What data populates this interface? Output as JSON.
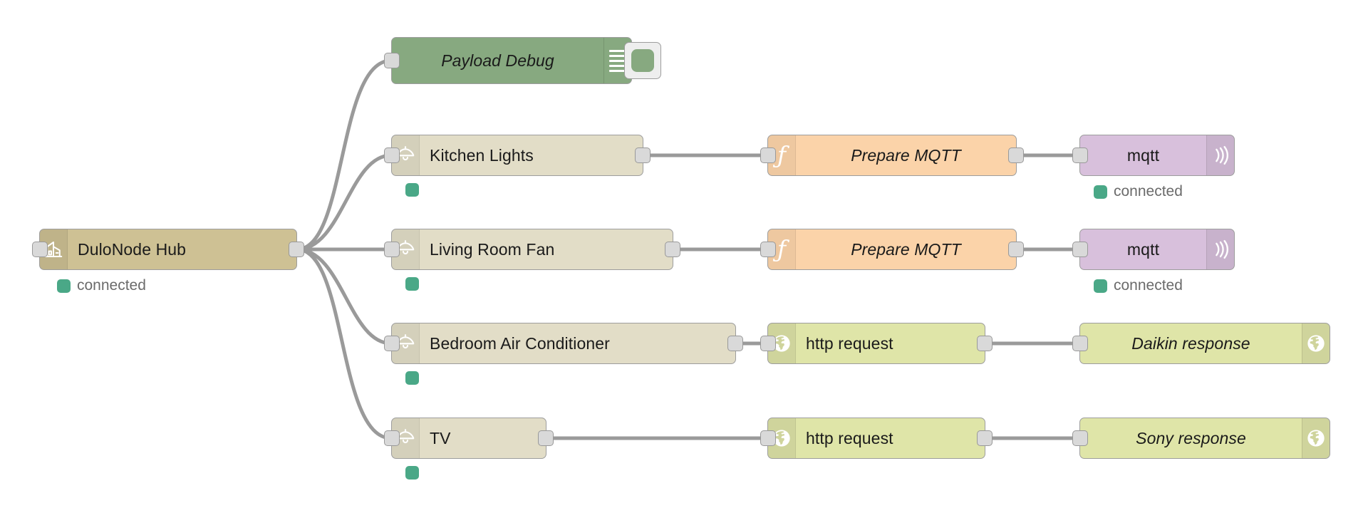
{
  "canvas": {
    "title": "Node-RED Flow Editor Canvas",
    "background_color": "#ffffff",
    "wire_color": "#9a9a9a"
  },
  "palette": {
    "hub_color": "#cec194",
    "device_color": "#e2ddc7",
    "debug_color": "#87a980",
    "function_color": "#fbd3a9",
    "mqtt_color": "#d8c0dc",
    "http_color": "#dfe5a8",
    "status_dot_color": "#4aa887",
    "port_color": "#d9d9d9"
  },
  "nodes": {
    "hub": {
      "label": "DuloNode Hub",
      "status": "connected",
      "icon": "building-icon",
      "type": "hub"
    },
    "payload_debug": {
      "label": "Payload Debug",
      "icon": "debug-lines-icon",
      "button": "debug-toggle-button",
      "type": "debug"
    },
    "kitchen_lights": {
      "label": "Kitchen Lights",
      "icon": "lamp-icon",
      "status": "",
      "type": "device"
    },
    "living_room_fan": {
      "label": "Living Room Fan",
      "icon": "lamp-icon",
      "status": "",
      "type": "device"
    },
    "bedroom_air_conditioner": {
      "label": "Bedroom Air Conditioner",
      "icon": "lamp-icon",
      "status": "",
      "type": "device"
    },
    "tv": {
      "label": "TV",
      "icon": "lamp-icon",
      "status": "",
      "type": "device"
    },
    "prepare_mqtt_1": {
      "label": "Prepare MQTT",
      "icon": "function-icon",
      "type": "function"
    },
    "prepare_mqtt_2": {
      "label": "Prepare MQTT",
      "icon": "function-icon",
      "type": "function"
    },
    "mqtt_1": {
      "label": "mqtt",
      "icon": "broadcast-icon",
      "status": "connected",
      "type": "mqtt"
    },
    "mqtt_2": {
      "label": "mqtt",
      "icon": "broadcast-icon",
      "status": "connected",
      "type": "mqtt"
    },
    "http_request_1": {
      "label": "http request",
      "icon": "globe-icon",
      "type": "http"
    },
    "http_request_2": {
      "label": "http request",
      "icon": "globe-icon",
      "type": "http"
    },
    "daikin_response": {
      "label": "Daikin response",
      "icon": "globe-icon",
      "type": "http"
    },
    "sony_response": {
      "label": "Sony response",
      "icon": "globe-icon",
      "type": "http"
    }
  }
}
